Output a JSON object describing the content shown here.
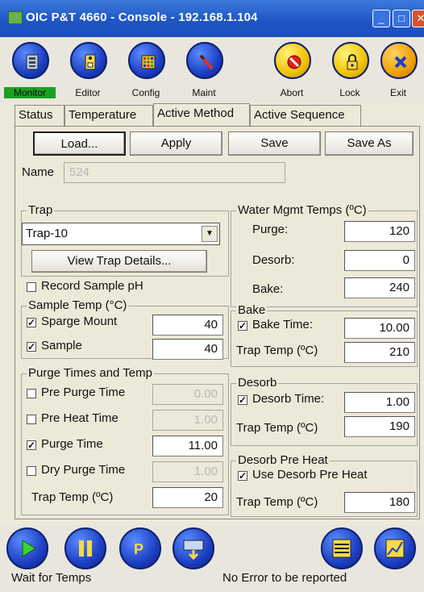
{
  "window": {
    "title": "OIC P&T 4660 - Console - 192.168.1.104"
  },
  "toolbar": [
    {
      "label": "Monitor",
      "icon": "monitor-icon"
    },
    {
      "label": "Editor",
      "icon": "editor-icon"
    },
    {
      "label": "Config",
      "icon": "config-icon"
    },
    {
      "label": "Maint",
      "icon": "maint-icon"
    },
    {
      "label": "Abort",
      "icon": "abort-icon"
    },
    {
      "label": "Lock",
      "icon": "lock-icon"
    },
    {
      "label": "Exit",
      "icon": "exit-icon"
    }
  ],
  "tabs": [
    "Status",
    "Temperature",
    "Active Method",
    "Active Sequence"
  ],
  "actions": {
    "load": "Load...",
    "apply": "Apply",
    "save": "Save",
    "save_as": "Save As"
  },
  "name": {
    "label": "Name",
    "value": "524"
  },
  "trap": {
    "title": "Trap",
    "selected": "Trap-10",
    "details_button": "View Trap Details..."
  },
  "record_ph": {
    "label": "Record Sample pH",
    "checked": false
  },
  "sample_temp": {
    "title": "Sample Temp (°C)",
    "sparge_label": "Sparge Mount",
    "sparge_value": "40",
    "sample_label": "Sample",
    "sample_value": "40"
  },
  "purge": {
    "title": "Purge Times and Temp",
    "pre_purge_label": "Pre Purge Time",
    "pre_purge_value": "0.00",
    "pre_heat_label": "Pre Heat Time",
    "pre_heat_value": "1.00",
    "purge_label": "Purge Time",
    "purge_value": "11.00",
    "dry_purge_label": "Dry Purge Time",
    "dry_purge_value": "1.00",
    "trap_temp_label": "Trap Temp (ºC)",
    "trap_temp_value": "20"
  },
  "water": {
    "title": "Water Mgmt Temps (ºC)",
    "purge_label": "Purge:",
    "purge_value": "120",
    "desorb_label": "Desorb:",
    "desorb_value": "0",
    "bake_label": "Bake:",
    "bake_value": "240"
  },
  "bake": {
    "title": "Bake",
    "time_label": "Bake Time:",
    "time_value": "10.00",
    "trap_label": "Trap Temp (ºC)",
    "trap_value": "210"
  },
  "desorb": {
    "title": "Desorb",
    "time_label": "Desorb Time:",
    "time_value": "1.00",
    "trap_label": "Trap Temp (ºC)",
    "trap_value": "190"
  },
  "desorb_preheat": {
    "title": "Desorb Pre Heat",
    "use_label": "Use Desorb Pre Heat",
    "trap_label": "Trap Temp (ºC)",
    "trap_value": "180"
  },
  "status": {
    "left": "Wait for Temps",
    "right": "No Error to be reported"
  },
  "colors": {
    "titlebar": "#1f55c4",
    "active_tool": "#1aa022",
    "button_blue": "#1d3fc2"
  }
}
